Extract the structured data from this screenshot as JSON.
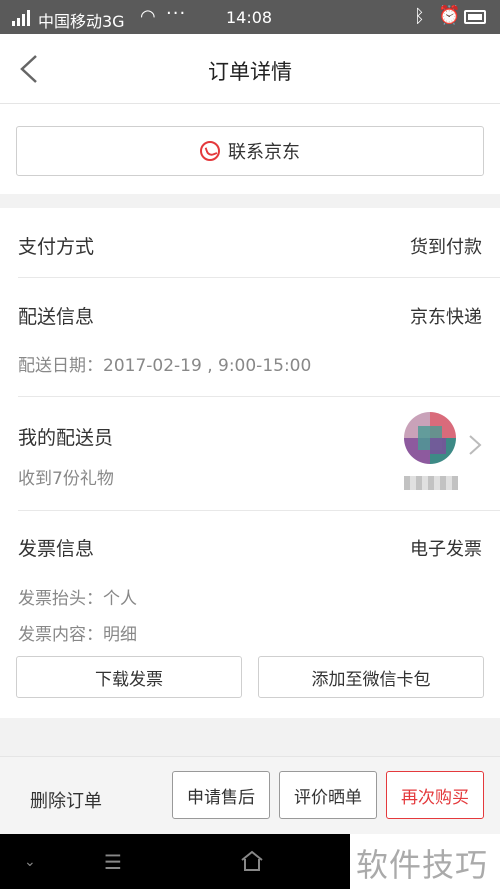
{
  "status_bar": {
    "carrier": "中国移动3G",
    "dots": "···",
    "time": "14:08"
  },
  "nav": {
    "title": "订单详情"
  },
  "contact": {
    "label": "联系京东"
  },
  "payment": {
    "label": "支付方式",
    "value": "货到付款"
  },
  "delivery": {
    "label": "配送信息",
    "value": "京东快递",
    "date": "配送日期：2017-02-19 , 9:00-15:00"
  },
  "courier": {
    "label": "我的配送员",
    "gifts": "收到7份礼物"
  },
  "invoice": {
    "label": "发票信息",
    "value": "电子发票",
    "header": "发票抬头：个人",
    "content": "发票内容：明细",
    "download_label": "下载发票",
    "wechat_label": "添加至微信卡包"
  },
  "actions": {
    "delete": "删除订单",
    "after_sales": "申请售后",
    "review": "评价晒单",
    "rebuy": "再次购买"
  },
  "watermark": "软件技巧",
  "colors": {
    "accent_red": "#e4393c",
    "status_bar": "#5a5a5a"
  }
}
